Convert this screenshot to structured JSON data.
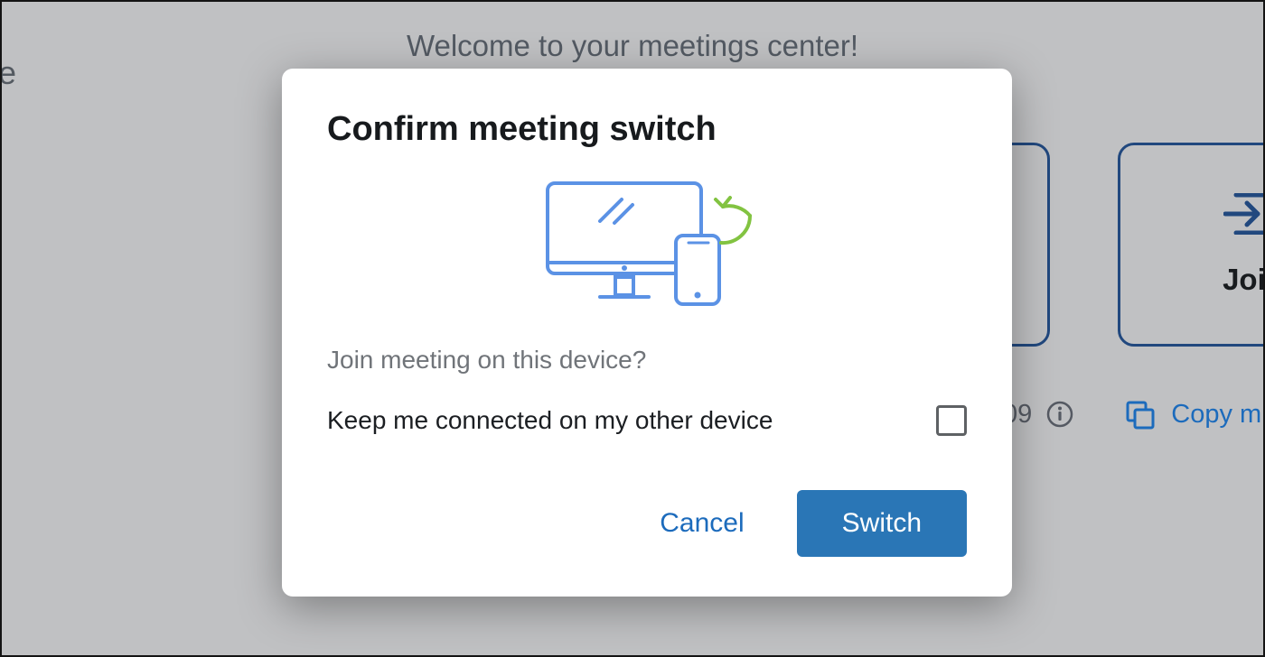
{
  "background": {
    "partial_left_text": "e",
    "welcome_text": "Welcome to your meetings center!",
    "join_card_label": "Join",
    "bottom_partial_number": "09",
    "copy_text": "Copy m"
  },
  "modal": {
    "title": "Confirm meeting switch",
    "question": "Join meeting on this device?",
    "checkbox_label": "Keep me connected on my other device",
    "cancel_label": "Cancel",
    "switch_label": "Switch"
  },
  "icons": {
    "device_switch": "device-switch-illustration",
    "join": "join-icon",
    "info": "info-icon",
    "copy": "copy-icon"
  }
}
